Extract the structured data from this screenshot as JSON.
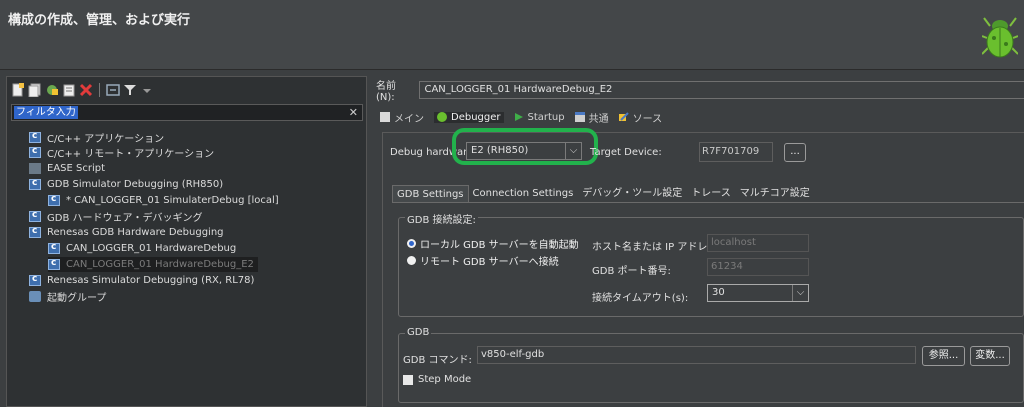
{
  "header": {
    "title": "構成の作成、管理、および実行"
  },
  "left": {
    "filter": {
      "placeholder": "フィルタ入力"
    },
    "toolbar_icons": [
      "new-config-icon",
      "duplicate-icon",
      "export-icon",
      "copy-icon",
      "delete-icon",
      "collapse-all-icon",
      "filter-icon",
      "dropdown-arrow-icon"
    ],
    "tree": [
      {
        "label": "C/C++ アプリケーション",
        "icon": "c-config-icon"
      },
      {
        "label": "C/C++ リモート・アプリケーション",
        "icon": "c-config-icon"
      },
      {
        "label": "EASE Script",
        "icon": "ease-script-icon"
      },
      {
        "label": "GDB Simulator Debugging (RH850)",
        "icon": "c-config-icon"
      },
      {
        "label": "* CAN_LOGGER_01 SimulaterDebug [local]",
        "icon": "c-config-icon"
      },
      {
        "label": "GDB ハードウェア・デバッギング",
        "icon": "c-config-icon"
      },
      {
        "label": "Renesas GDB Hardware Debugging",
        "icon": "c-config-icon"
      },
      {
        "label": "CAN_LOGGER_01 HardwareDebug",
        "icon": "c-config-icon"
      },
      {
        "label": "CAN_LOGGER_01 HardwareDebug_E2",
        "icon": "c-config-icon"
      },
      {
        "label": "Renesas Simulator Debugging (RX, RL78)",
        "icon": "c-config-icon"
      },
      {
        "label": "起動グループ",
        "icon": "launch-group-icon"
      }
    ]
  },
  "right": {
    "name_label": "名前(N):",
    "name_value": "CAN_LOGGER_01 HardwareDebug_E2",
    "tabs": [
      {
        "label": "メイン",
        "icon": "main-tab-icon"
      },
      {
        "label": "Debugger",
        "icon": "debugger-tab-icon"
      },
      {
        "label": "Startup",
        "icon": "startup-tab-icon"
      },
      {
        "label": "共通",
        "icon": "common-tab-icon"
      },
      {
        "label": "ソース",
        "icon": "source-tab-icon"
      }
    ],
    "debug_hardware_label": "Debug hardware:",
    "debug_hardware_value": "E2 (RH850)",
    "target_device_label": "Target Device:",
    "target_device_value": "R7F701709",
    "browse_button": "...",
    "subtabs": [
      "GDB Settings",
      "Connection Settings",
      "デバッグ・ツール設定",
      "トレース",
      "マルチコア設定"
    ],
    "gdb_connection": {
      "title": "GDB 接続設定:",
      "local_radio": "ローカル GDB サーバーを自動起動",
      "remote_radio": "リモート GDB サーバーへ接続",
      "host_label": "ホスト名または IP アドレス:",
      "host_value": "localhost",
      "port_label": "GDB ポート番号:",
      "port_value": "61234",
      "timeout_label": "接続タイムアウト(s):",
      "timeout_value": "30"
    },
    "gdb": {
      "title": "GDB",
      "command_label": "GDB コマンド:",
      "command_value": "v850-elf-gdb",
      "browse_button": "参照...",
      "variables_button": "変数...",
      "step_mode_label": "Step Mode"
    }
  },
  "colors": {
    "highlight_ring": "#22b24c",
    "selection_blue": "#2f65ca"
  }
}
